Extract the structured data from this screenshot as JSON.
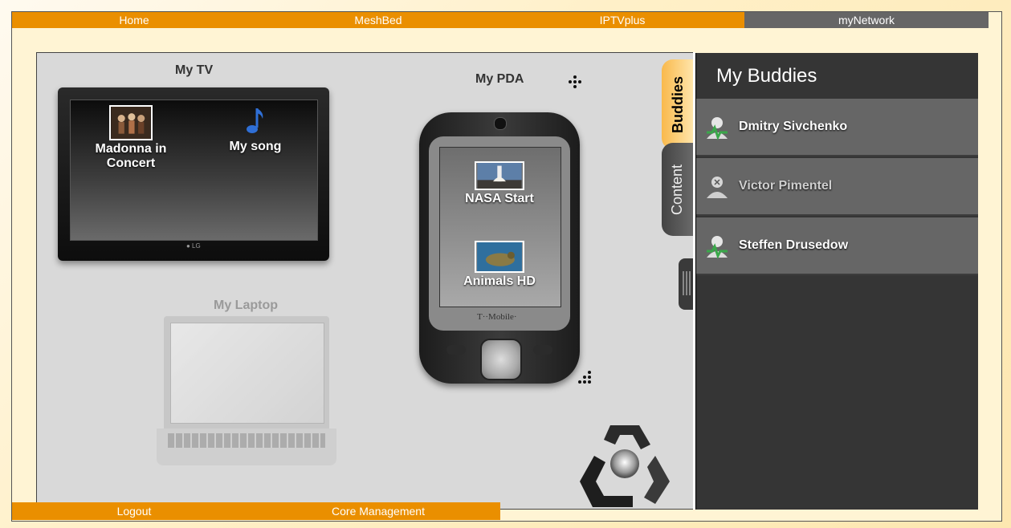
{
  "nav": {
    "tabs": [
      {
        "label": "Home",
        "active": false
      },
      {
        "label": "MeshBed",
        "active": false
      },
      {
        "label": "IPTVplus",
        "active": false
      },
      {
        "label": "myNetwork",
        "active": true
      }
    ]
  },
  "bottom_nav": {
    "items": [
      {
        "label": "Logout"
      },
      {
        "label": "Core Management"
      }
    ]
  },
  "devices": {
    "tv": {
      "title": "My TV",
      "items": [
        {
          "label_line1": "Madonna in",
          "label_line2": "Concert",
          "icon": "video-thumbnail"
        },
        {
          "label": "My song",
          "icon": "music-note-icon"
        }
      ]
    },
    "pda": {
      "title": "My PDA",
      "brand": "T··Mobile·",
      "items": [
        {
          "label": "NASA Start",
          "icon": "video-thumbnail"
        },
        {
          "label": "Animals HD",
          "icon": "video-thumbnail"
        }
      ]
    },
    "laptop": {
      "title": "My Laptop",
      "enabled": false
    }
  },
  "side_tabs": [
    {
      "label": "Buddies",
      "active": true
    },
    {
      "label": "Content",
      "active": false
    }
  ],
  "buddies": {
    "title": "My Buddies",
    "list": [
      {
        "name": "Dmitry Sivchenko",
        "status": "online"
      },
      {
        "name": "Victor Pimentel",
        "status": "offline"
      },
      {
        "name": "Steffen Drusedow",
        "status": "online"
      }
    ]
  },
  "colors": {
    "accent": "#ea8f00",
    "active_tab": "#666666",
    "panel_dark": "#353535",
    "row": "#666666",
    "online": "#3aa84a"
  }
}
